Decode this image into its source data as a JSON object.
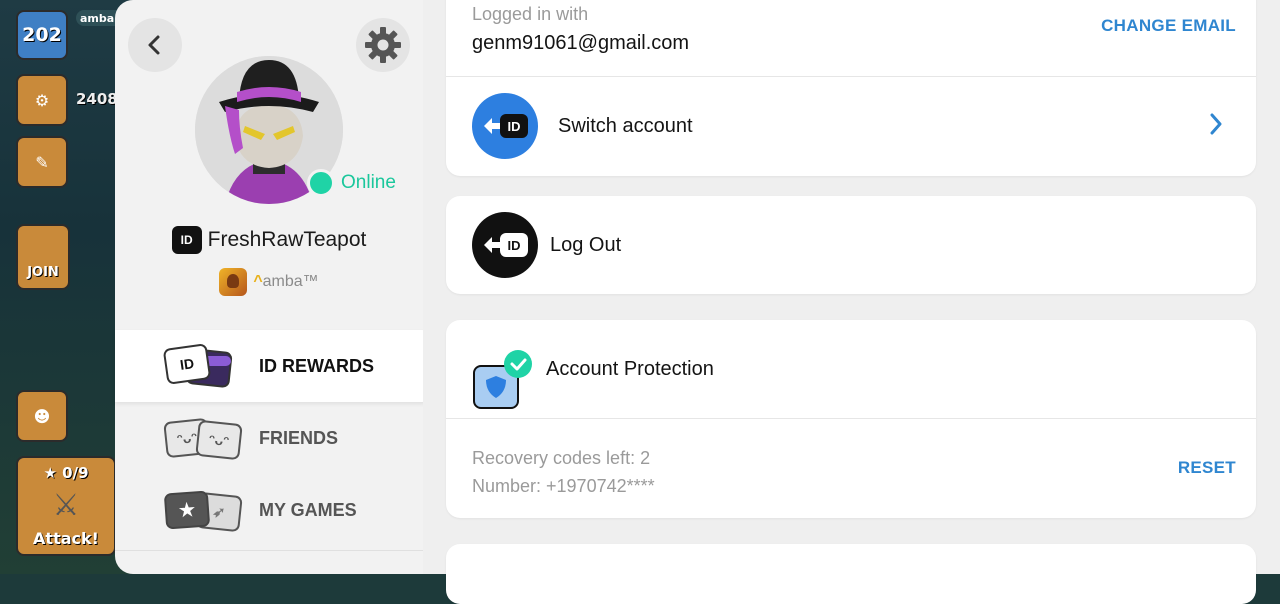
{
  "game": {
    "level": "202",
    "player_name": "amba",
    "resource_count": "2408",
    "join_label": "JOIN",
    "attack_stars": "0/9",
    "attack_label": "Attack!"
  },
  "profile": {
    "status": "Online",
    "id_badge": "ID",
    "username": "FreshRawTeapot",
    "clan_name": "amba™",
    "clan_prefix": "^"
  },
  "nav": {
    "items": [
      {
        "label": "ID REWARDS"
      },
      {
        "label": "FRIENDS"
      },
      {
        "label": "MY GAMES"
      }
    ]
  },
  "account": {
    "logged_in_label": "Logged in with",
    "email": "genm91061@gmail.com",
    "change_email_label": "CHANGE EMAIL",
    "switch_account_label": "Switch account",
    "logout_label": "Log Out",
    "protection_label": "Account Protection",
    "recovery_codes": "Recovery codes left: 2",
    "number": "Number: +1970742****",
    "reset_label": "RESET"
  },
  "colors": {
    "accent_blue": "#2f86d0",
    "online_green": "#1fd3a6",
    "switch_blue": "#2d7fe0"
  }
}
